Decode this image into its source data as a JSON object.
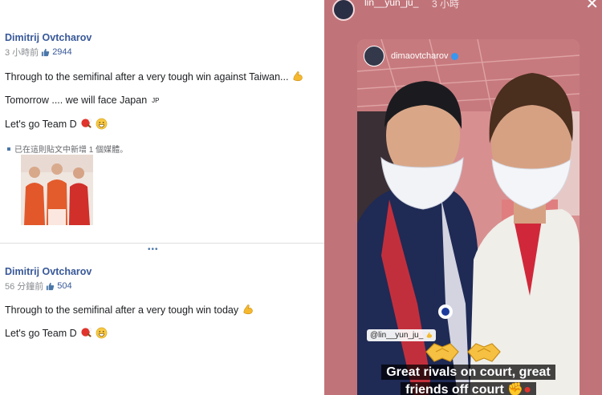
{
  "facebook": {
    "posts": [
      {
        "author": "Dimitrij Ovtcharov",
        "time": "3 小時前",
        "likes": "2944",
        "lines": [
          "Through to the semifinal after a very tough win against Taiwan...",
          "Tomorrow .... we will face Japan",
          "Let's go Team D"
        ],
        "flag_label": "JP",
        "media_note": "已在這則貼文中新增 1 個媒體。"
      },
      {
        "author": "Dimitrij Ovtcharov",
        "time": "56 分鐘前",
        "likes": "504",
        "lines": [
          "Through to the semifinal after a very tough win today",
          "Let's go Team D"
        ]
      }
    ],
    "more": "•••"
  },
  "story": {
    "username": "lin__yun_ju_",
    "time": "3 小時",
    "close_icon": "close-icon",
    "inner_username": "dimaovtcharov",
    "mention": "@lin__yun_ju_",
    "caption_line1": "Great rivals on court, great",
    "caption_line2": "friends off court"
  },
  "colors": {
    "link_blue": "#385898",
    "story_bg": "#c07479",
    "verified_blue": "#3897f0"
  }
}
